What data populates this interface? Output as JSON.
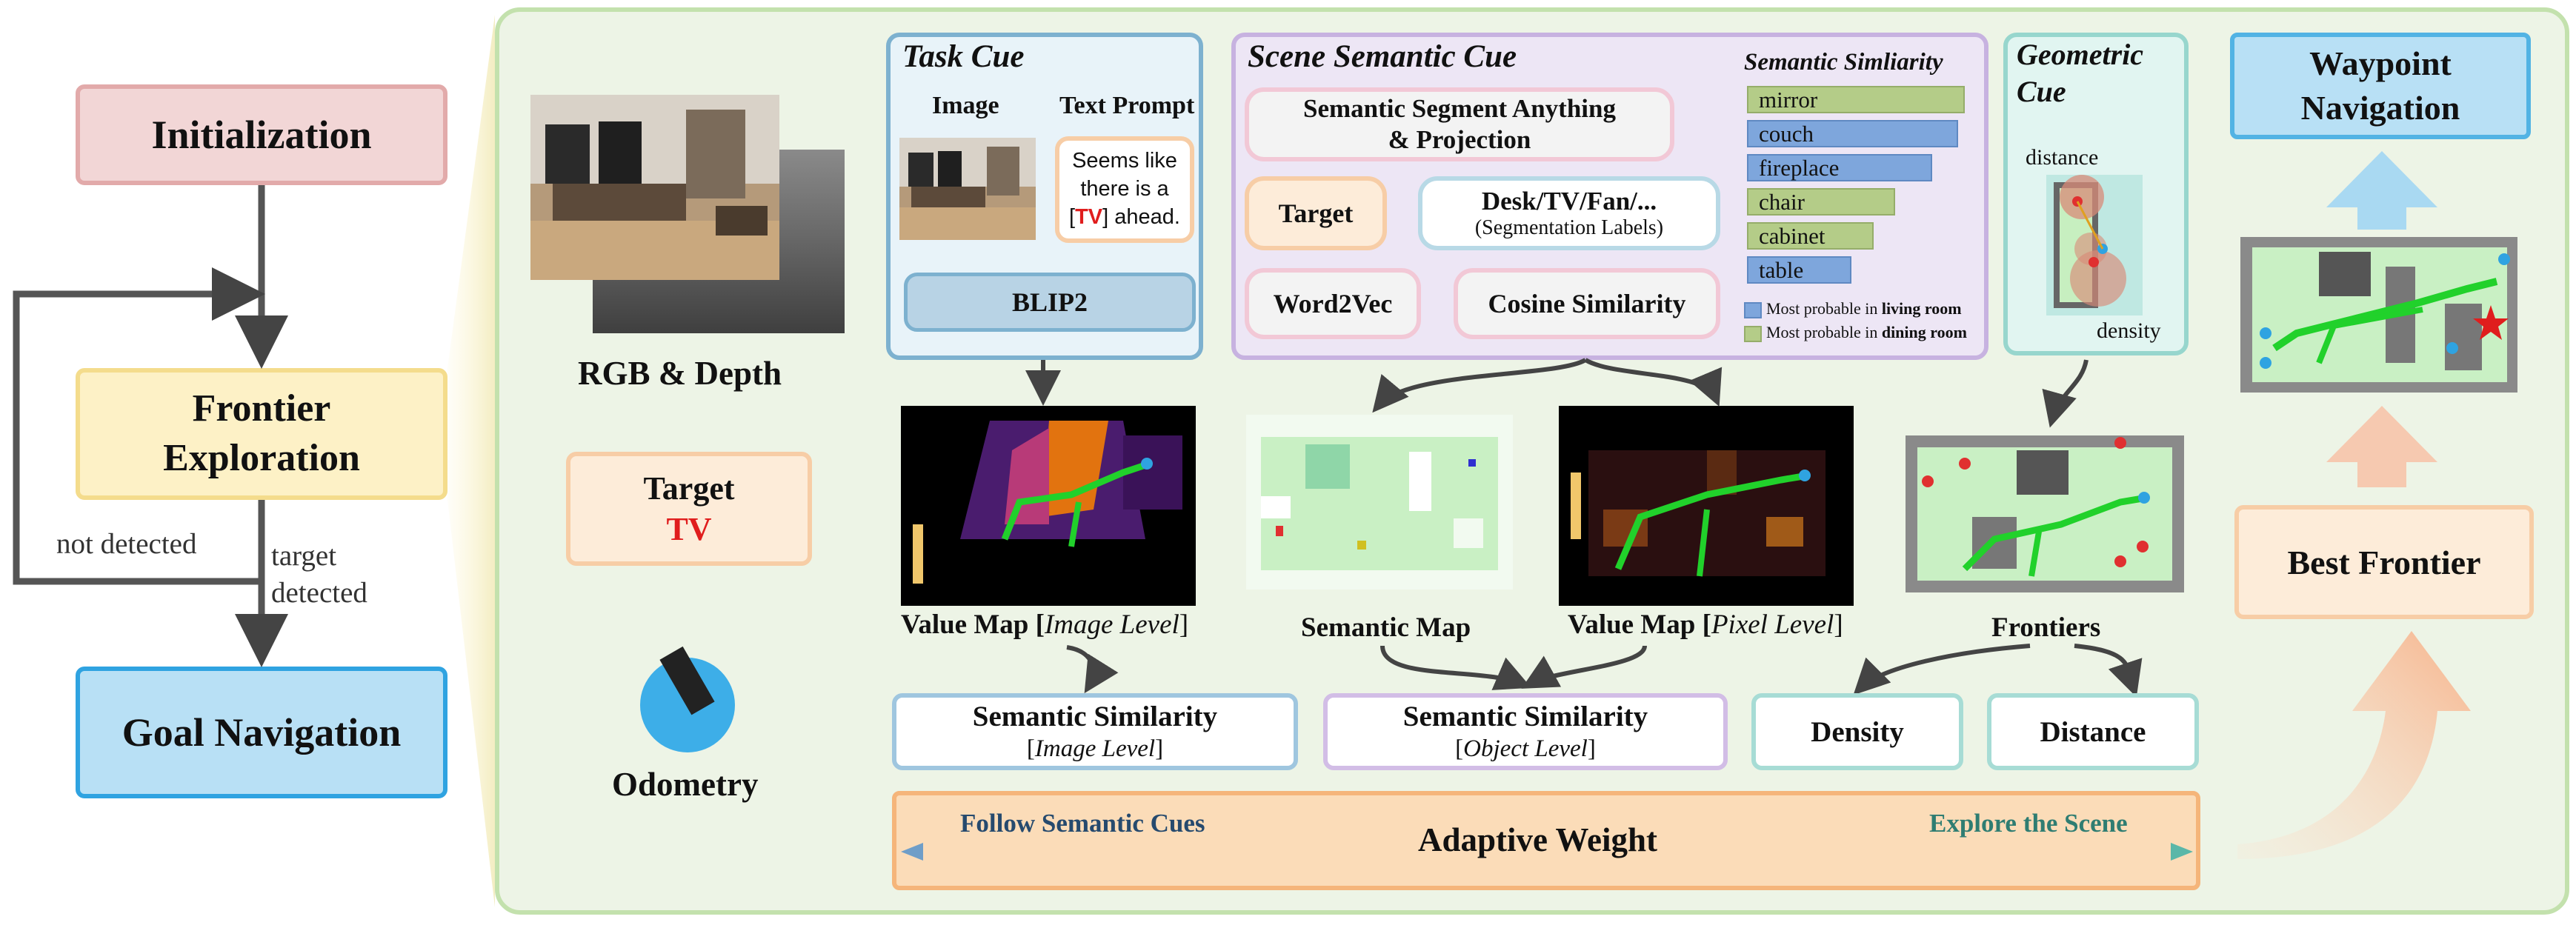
{
  "flow": {
    "initialization": "Initialization",
    "frontier_l1": "Frontier",
    "frontier_l2": "Exploration",
    "goal_navigation": "Goal Navigation",
    "not_detected": "not detected",
    "target_detected_l1": "target",
    "target_detected_l2": "detected"
  },
  "inputs": {
    "rgb_depth": "RGB & Depth",
    "target_label": "Target",
    "target_value": "TV",
    "odometry": "Odometry"
  },
  "task_cue": {
    "title": "Task Cue",
    "image_label": "Image",
    "text_prompt_label": "Text Prompt",
    "prompt_l1": "Seems like",
    "prompt_l2": "there is a",
    "prompt_bracket_open": "[",
    "prompt_target": "TV",
    "prompt_bracket_close": "] ahead.",
    "blip2": "BLIP2"
  },
  "scene_cue": {
    "title": "Scene Semantic Cue",
    "ssa_l1": "Semantic Segment Anything",
    "ssa_l2": "& Projection",
    "target": "Target",
    "labels_l1": "Desk/TV/Fan/...",
    "labels_l2": "(Segmentation Labels)",
    "word2vec": "Word2Vec",
    "cosine": "Cosine Similarity",
    "similarity_title": "Semantic Simliarity",
    "legend_living_prefix": "Most probable in ",
    "legend_living_bold": "living room",
    "legend_dining_prefix": "Most probable in ",
    "legend_dining_bold": "dining room",
    "colors": {
      "living": "#7ea6dc",
      "dining": "#b4cc88"
    }
  },
  "chart_data": {
    "type": "bar",
    "title": "Semantic Simliarity",
    "categories": [
      "mirror",
      "couch",
      "fireplace",
      "chair",
      "cabinet",
      "table"
    ],
    "values": [
      1.0,
      0.97,
      0.85,
      0.68,
      0.58,
      0.48
    ],
    "room": [
      "dining",
      "living",
      "living",
      "dining",
      "dining",
      "living"
    ],
    "legend": [
      "Most probable in living room",
      "Most probable in dining room"
    ]
  },
  "geometric_cue": {
    "title_l1": "Geometric",
    "title_l2": "Cue",
    "distance": "distance",
    "density": "density"
  },
  "maps": {
    "value_image_prefix": "Value Map [",
    "value_image_italic": "Image Level",
    "value_image_suffix": "]",
    "semantic_map": "Semantic Map",
    "value_pixel_prefix": "Value Map [",
    "value_pixel_italic": "Pixel Level",
    "value_pixel_suffix": "]",
    "frontiers": "Frontiers"
  },
  "scores": {
    "img_sim_l1": "Semantic Similarity",
    "img_sim_l2_open": "[",
    "img_sim_l2_italic": "Image Level",
    "img_sim_l2_close": "]",
    "obj_sim_l1": "Semantic Similarity",
    "obj_sim_l2_open": "[",
    "obj_sim_l2_italic": "Object Level",
    "obj_sim_l2_close": "]",
    "density": "Density",
    "distance": "Distance"
  },
  "adaptive": {
    "title": "Adaptive Weight",
    "left": "Follow Semantic Cues",
    "right": "Explore the Scene"
  },
  "right_col": {
    "waypoint_l1": "Waypoint",
    "waypoint_l2": "Navigation",
    "best_frontier": "Best Frontier"
  }
}
